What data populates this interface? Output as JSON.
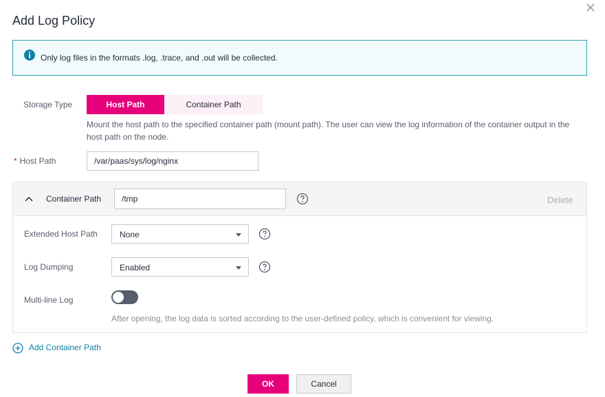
{
  "dialog": {
    "title": "Add Log Policy",
    "close_icon": "close-icon"
  },
  "info_banner": {
    "icon": "info-icon",
    "text": "Only log files in the formats .log, .trace, and .out will be collected."
  },
  "storage_type": {
    "label": "Storage Type",
    "options": [
      "Host Path",
      "Container Path"
    ],
    "selected": "Host Path",
    "hint": "Mount the host path to the specified container path (mount path). The user can view the log information of the container output in the host path on the node."
  },
  "host_path": {
    "required_mark": "*",
    "label": "Host Path",
    "value": "/var/paas/sys/log/nginx"
  },
  "container_panel": {
    "label": "Container Path",
    "value": "/tmp",
    "delete_label": "Delete",
    "extended_host_path": {
      "label": "Extended Host Path",
      "value": "None"
    },
    "log_dumping": {
      "label": "Log Dumping",
      "value": "Enabled"
    },
    "multi_line_log": {
      "label": "Multi-line Log",
      "enabled": false,
      "hint": "After opening, the log data is sorted according to the user-defined policy, which is convenient for viewing."
    }
  },
  "add_container": {
    "label": "Add Container Path"
  },
  "footer": {
    "ok_label": "OK",
    "cancel_label": "Cancel"
  },
  "colors": {
    "accent": "#e6007a",
    "link": "#0d82a8",
    "info_border": "#26a0b0"
  }
}
